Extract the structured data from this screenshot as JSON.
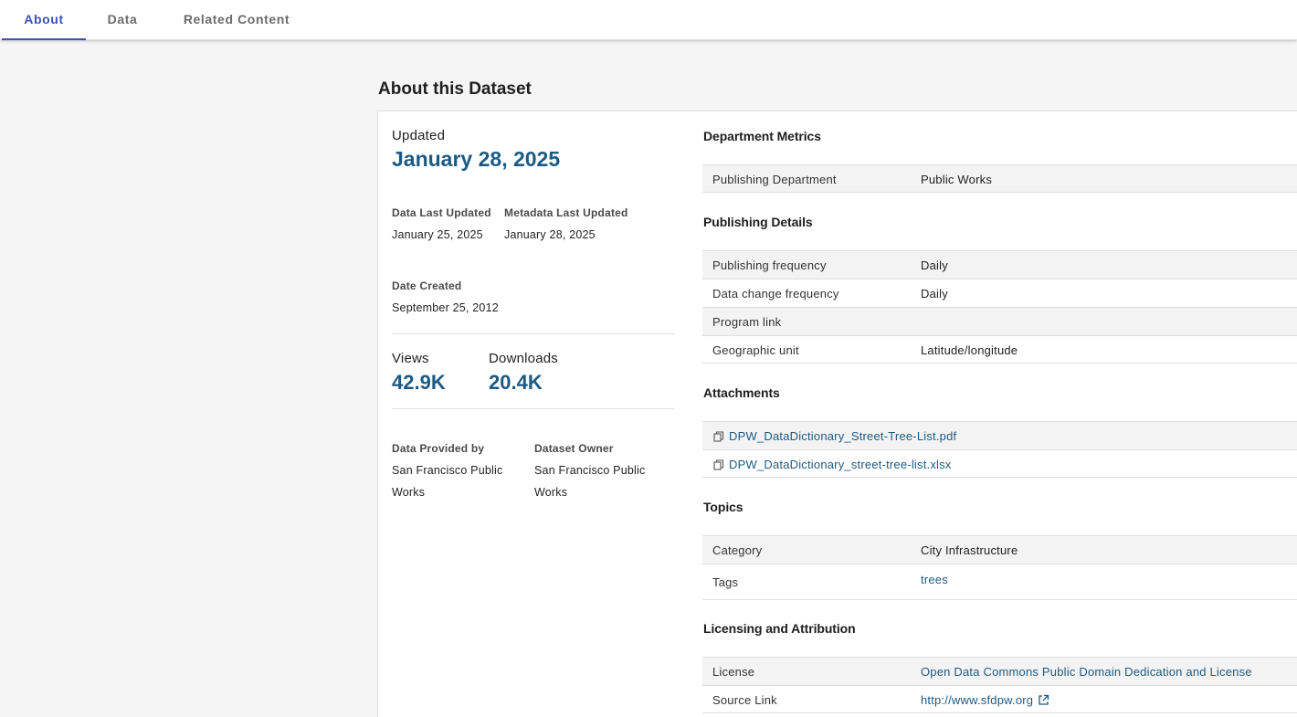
{
  "tabs": [
    {
      "label": "About"
    },
    {
      "label": "Data"
    },
    {
      "label": "Related Content"
    }
  ],
  "page_title": "About this Dataset",
  "summary": {
    "updated_label": "Updated",
    "updated_value": "January 28, 2025",
    "data_last_updated_label": "Data Last Updated",
    "data_last_updated_value": "January 25, 2025",
    "metadata_last_updated_label": "Metadata Last Updated",
    "metadata_last_updated_value": "January 28, 2025",
    "date_created_label": "Date Created",
    "date_created_value": "September 25, 2012",
    "views_label": "Views",
    "views_value": "42.9K",
    "downloads_label": "Downloads",
    "downloads_value": "20.4K",
    "provided_by_label": "Data Provided by",
    "provided_by_value": "San Francisco Public Works",
    "owner_label": "Dataset Owner",
    "owner_value": "San Francisco Public Works"
  },
  "sections": {
    "department_metrics": {
      "title": "Department Metrics",
      "rows": [
        {
          "key": "Publishing Department",
          "value": "Public Works"
        }
      ]
    },
    "publishing_details": {
      "title": "Publishing Details",
      "rows": [
        {
          "key": "Publishing frequency",
          "value": "Daily"
        },
        {
          "key": "Data change frequency",
          "value": "Daily"
        },
        {
          "key": "Program link",
          "value": ""
        },
        {
          "key": "Geographic unit",
          "value": "Latitude/longitude"
        }
      ]
    },
    "attachments": {
      "title": "Attachments",
      "files": [
        "DPW_DataDictionary_Street-Tree-List.pdf",
        "DPW_DataDictionary_street-tree-list.xlsx"
      ]
    },
    "topics": {
      "title": "Topics",
      "category_label": "Category",
      "category_value": "City Infrastructure",
      "tags_label": "Tags",
      "tags_value": "trees"
    },
    "licensing": {
      "title": "Licensing and Attribution",
      "license_label": "License",
      "license_value": "Open Data Commons Public Domain Dedication and License",
      "source_label": "Source Link",
      "source_value": "http://www.sfdpw.org"
    }
  },
  "colors": {
    "accent_tab": "#3f51b5",
    "value_blue": "#1c5a85",
    "page_bg": "#f5f5f5"
  }
}
